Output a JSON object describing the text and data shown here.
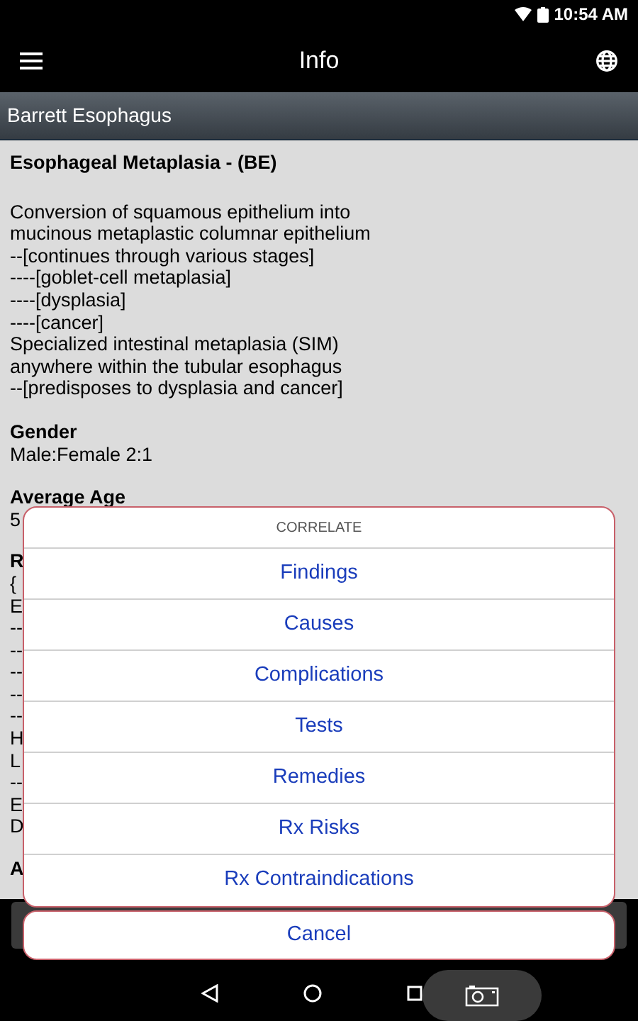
{
  "status_bar": {
    "time": "10:54 AM"
  },
  "app_bar": {
    "title": "Info"
  },
  "subtitle": "Barrett Esophagus",
  "content": {
    "heading": "Esophageal Metaplasia  - (BE)",
    "paragraph": [
      "Conversion of squamous epithelium into",
      "mucinous metaplastic columnar epithelium",
      "--[continues through various stages]",
      "----[goblet-cell metaplasia]",
      "----[dysplasia]",
      "----[cancer]",
      "Specialized intestinal metaplasia (SIM)",
      "anywhere within the tubular esophagus",
      "--[predisposes to dysplasia and cancer]"
    ],
    "sections": [
      {
        "title": "Gender",
        "lines": [
          "Male:Female 2:1"
        ]
      },
      {
        "title": "Average Age",
        "lines": [
          "5"
        ]
      }
    ],
    "obscured_lines": [
      {
        "text": "R",
        "bold": true
      },
      {
        "text": "{",
        "bold": false
      },
      {
        "text": "E",
        "bold": false
      },
      {
        "text": "--",
        "bold": false
      },
      {
        "text": "--",
        "bold": false
      },
      {
        "text": "--",
        "bold": false
      },
      {
        "text": "--",
        "bold": false
      },
      {
        "text": "--",
        "bold": false
      },
      {
        "text": "H",
        "bold": false
      },
      {
        "text": "L",
        "bold": false
      },
      {
        "text": "--",
        "bold": false
      },
      {
        "text": "E",
        "bold": false
      },
      {
        "text": "D",
        "bold": false
      },
      {
        "text": "A",
        "bold": true
      }
    ]
  },
  "dialog": {
    "title": "CORRELATE",
    "options": [
      "Findings",
      "Causes",
      "Complications",
      "Tests",
      "Remedies",
      "Rx Risks",
      "Rx Contraindications"
    ],
    "cancel": "Cancel"
  }
}
